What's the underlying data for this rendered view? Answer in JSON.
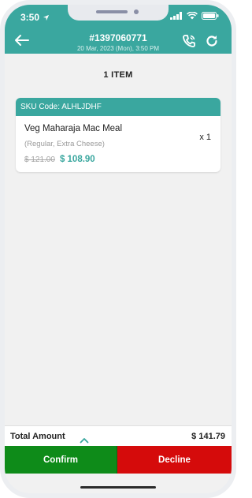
{
  "status_bar": {
    "time": "3:50"
  },
  "header": {
    "order_id": "#1397060771",
    "order_date": "20 Mar, 2023 (Mon),  3:50 PM",
    "back_icon": "arrow-left-icon",
    "call_icon": "phone-call-icon",
    "refresh_icon": "refresh-icon"
  },
  "summary": {
    "items_count": "1 ITEM"
  },
  "order_items": [
    {
      "sku_label": "SKU Code: ALHLJDHF",
      "name": "Veg Maharaja Mac Meal",
      "options": "(Regular, Extra Cheese)",
      "quantity": "x 1",
      "original_price": "$ 121.00",
      "final_price": "$ 108.90"
    }
  ],
  "footer": {
    "total_label": "Total Amount",
    "total_value": "$ 141.79",
    "confirm_label": "Confirm",
    "decline_label": "Decline"
  },
  "colors": {
    "accent": "#3aa79f",
    "confirm": "#0e8b19",
    "decline": "#d50b0b",
    "background": "#f1f1f1"
  }
}
